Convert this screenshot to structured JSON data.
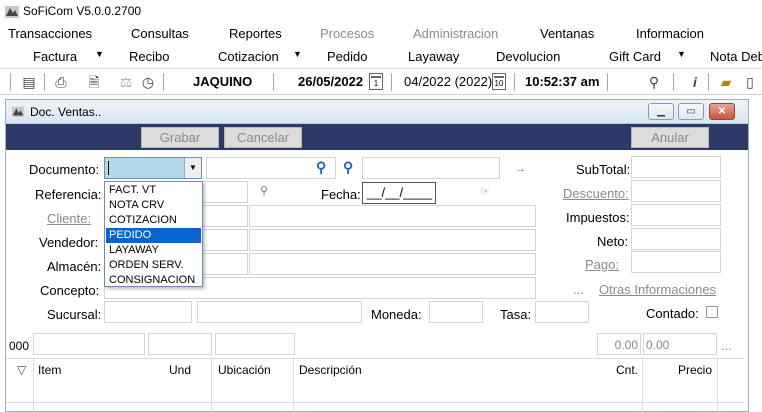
{
  "app": {
    "title": "SoFiCom V5.0.0.2700"
  },
  "menu": [
    "Transacciones",
    "Consultas",
    "Reportes",
    "Procesos",
    "Administracion",
    "Ventanas",
    "Informacion"
  ],
  "submenu": [
    "Factura",
    "Recibo",
    "Cotizacion",
    "Pedido",
    "Layaway",
    "Devolucion",
    "Gift Card",
    "Nota Debi"
  ],
  "status": {
    "user": "JAQUINO",
    "date": "26/05/2022",
    "period": "04/2022 (2022)",
    "time": "10:52:37 am",
    "cal1_day": "1",
    "cal2_day": "10"
  },
  "window": {
    "title": "Doc. Ventas.."
  },
  "actions": {
    "grabar": "Grabar",
    "cancelar": "Cancelar",
    "anular": "Anular"
  },
  "form": {
    "documento": "Documento:",
    "referencia": "Referencia:",
    "cliente": "Cliente:",
    "vendedor": "Vendedor:",
    "almacen": "Almacén:",
    "concepto": "Concepto:",
    "sucursal": "Sucursal:",
    "fecha": "Fecha:",
    "fecha_value": "__/__/____",
    "moneda": "Moneda:",
    "tasa": "Tasa:",
    "subtotal": "SubTotal:",
    "descuento": "Descuento:",
    "impuestos": "Impuestos:",
    "neto": "Neto:",
    "pago": "Pago:",
    "otras": "Otras Informaciones",
    "contado": "Contado:",
    "ellipsis": "...",
    "arrow": "→"
  },
  "doc_options": [
    "FACT. VT",
    "NOTA CRV",
    "COTIZACION",
    "PEDIDO",
    "LAYAWAY",
    "ORDEN SERV.",
    "CONSIGNACION"
  ],
  "doc_selected": "PEDIDO",
  "grid": {
    "row_code": "000",
    "amount1": "0.00",
    "amount2": "0.00",
    "ellipsis": "...",
    "sort_icon": "▽",
    "headers": [
      "Item",
      "Und",
      "Ubicación",
      "Descripción",
      "Cnt.",
      "Precio"
    ]
  }
}
